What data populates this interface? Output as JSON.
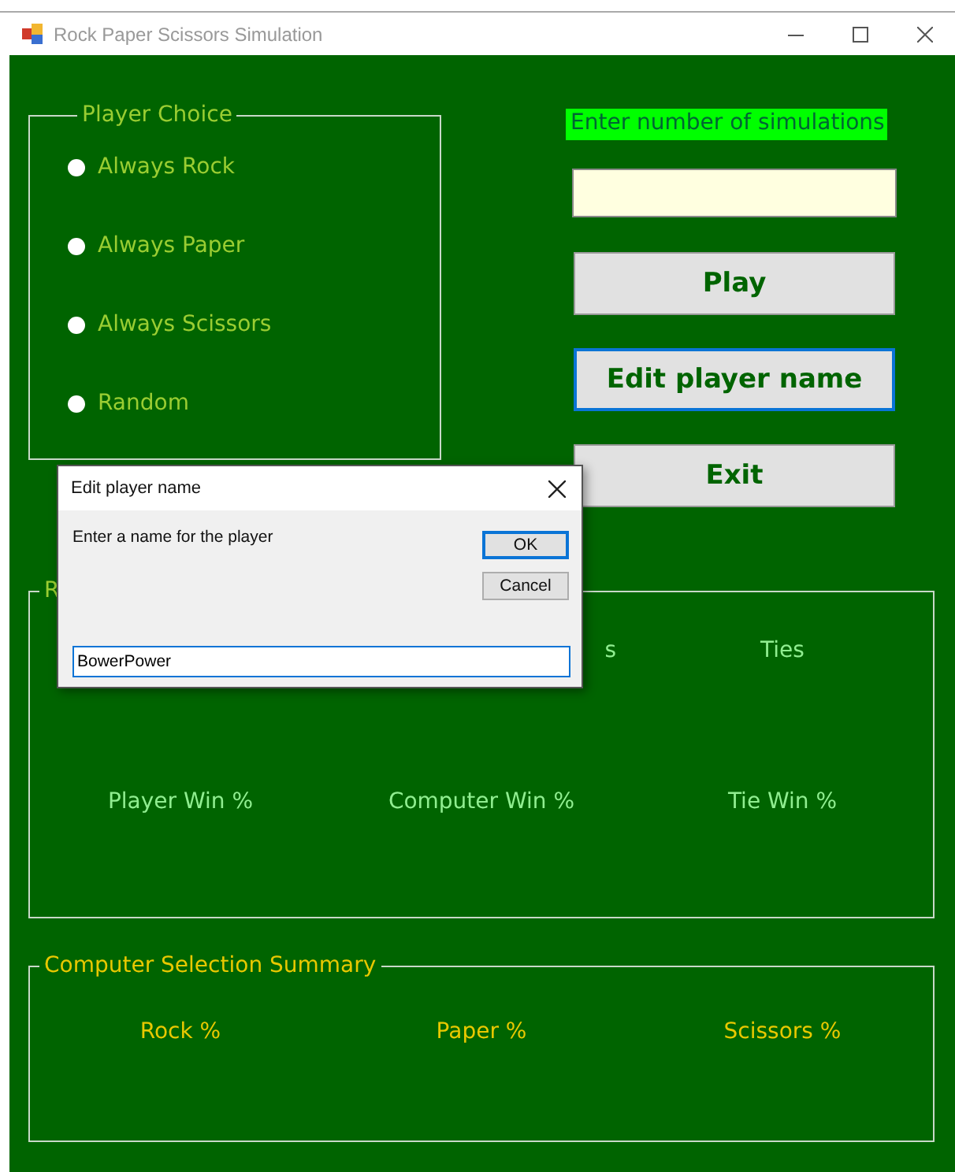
{
  "window": {
    "title": "Rock Paper Scissors Simulation"
  },
  "player_choice": {
    "title": "Player Choice",
    "options": [
      {
        "label": "Always Rock",
        "selected": false
      },
      {
        "label": "Always Paper",
        "selected": false
      },
      {
        "label": "Always Scissors",
        "selected": false
      },
      {
        "label": "Random",
        "selected": false
      }
    ]
  },
  "simulations": {
    "label": "Enter number of simulations"
  },
  "buttons": [
    {
      "label": "Play",
      "focused": false
    },
    {
      "label": "Edit player name",
      "focused": true
    },
    {
      "label": "Exit",
      "focused": false
    }
  ],
  "results": {
    "title": "R",
    "row_1": {
      "column_2": "s",
      "column_3": "Ties"
    },
    "row_2": [
      "Player Win %",
      "Computer Win %",
      "Tie Win %"
    ]
  },
  "computer_summary": {
    "title": "Computer Selection Summary",
    "labels": [
      "Rock %",
      "Paper %",
      "Scissors %"
    ]
  },
  "dialog": {
    "title": "Edit player name",
    "prompt": "Enter a name for the player",
    "buttons": [
      {
        "label": "OK",
        "focused": true
      },
      {
        "label": "Cancel",
        "focused": false
      }
    ],
    "value": "BowerPower"
  }
}
